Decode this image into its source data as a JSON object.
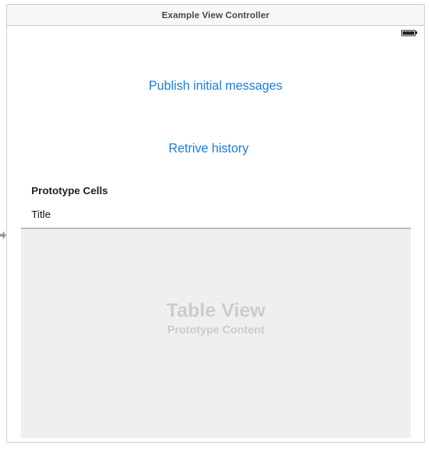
{
  "scene": {
    "title": "Example View Controller"
  },
  "buttons": {
    "publish_label": "Publish initial messages",
    "history_label": "Retrive history"
  },
  "table": {
    "section_header": "Prototype Cells",
    "cell_title": "Title",
    "placeholder_title": "Table View",
    "placeholder_subtitle": "Prototype Content"
  },
  "colors": {
    "link": "#1b7ee0",
    "table_background": "#efefef",
    "placeholder_text": "#cccccc"
  },
  "icons": {
    "status": "battery-icon",
    "entry": "entry-point-arrow-icon"
  }
}
